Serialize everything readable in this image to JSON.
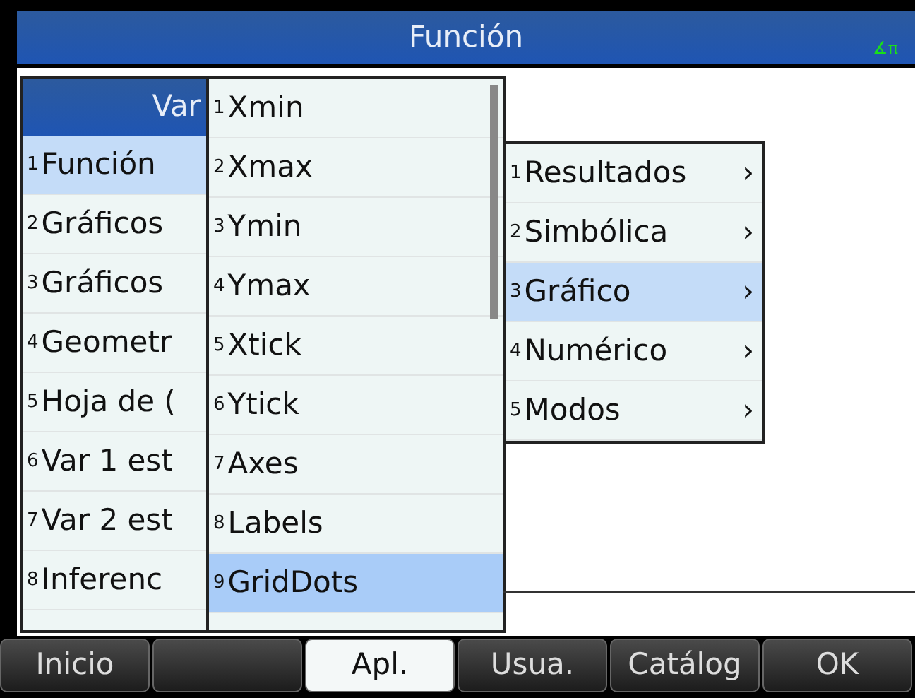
{
  "title_bar": {
    "title": "Función",
    "indicator": "∡π"
  },
  "app_menu": {
    "header": "Var",
    "items": [
      {
        "num": "1",
        "label": "Función",
        "selected": true
      },
      {
        "num": "2",
        "label": "Gráficos",
        "selected": false
      },
      {
        "num": "3",
        "label": "Gráficos",
        "selected": false
      },
      {
        "num": "4",
        "label": "Geometr",
        "selected": false
      },
      {
        "num": "5",
        "label": "Hoja de (",
        "selected": false
      },
      {
        "num": "6",
        "label": "Var 1 est",
        "selected": false
      },
      {
        "num": "7",
        "label": "Var 2 est",
        "selected": false
      },
      {
        "num": "8",
        "label": "Inferenc",
        "selected": false
      }
    ]
  },
  "variable_menu": {
    "items": [
      {
        "num": "1",
        "label": "Xmin",
        "selected": false
      },
      {
        "num": "2",
        "label": "Xmax",
        "selected": false
      },
      {
        "num": "3",
        "label": "Ymin",
        "selected": false
      },
      {
        "num": "4",
        "label": "Ymax",
        "selected": false
      },
      {
        "num": "5",
        "label": "Xtick",
        "selected": false
      },
      {
        "num": "6",
        "label": "Ytick",
        "selected": false
      },
      {
        "num": "7",
        "label": "Axes",
        "selected": false
      },
      {
        "num": "8",
        "label": "Labels",
        "selected": false
      },
      {
        "num": "9",
        "label": "GridDots",
        "selected": true
      }
    ]
  },
  "view_menu": {
    "items": [
      {
        "num": "1",
        "label": "Resultados",
        "arrow": "›",
        "selected": false
      },
      {
        "num": "2",
        "label": "Simbólica",
        "arrow": "›",
        "selected": false
      },
      {
        "num": "3",
        "label": "Gráfico",
        "arrow": "›",
        "selected": true
      },
      {
        "num": "4",
        "label": "Numérico",
        "arrow": "›",
        "selected": false
      },
      {
        "num": "5",
        "label": "Modos",
        "arrow": "›",
        "selected": false
      }
    ]
  },
  "soft_keys": [
    {
      "label": "Inicio",
      "selected": false
    },
    {
      "selected": false
    },
    {
      "label": "Apl.",
      "selected": true
    },
    {
      "label": "Usua.",
      "selected": false
    },
    {
      "label": "Catálog",
      "selected": false
    },
    {
      "label": "OK",
      "selected": false
    }
  ]
}
